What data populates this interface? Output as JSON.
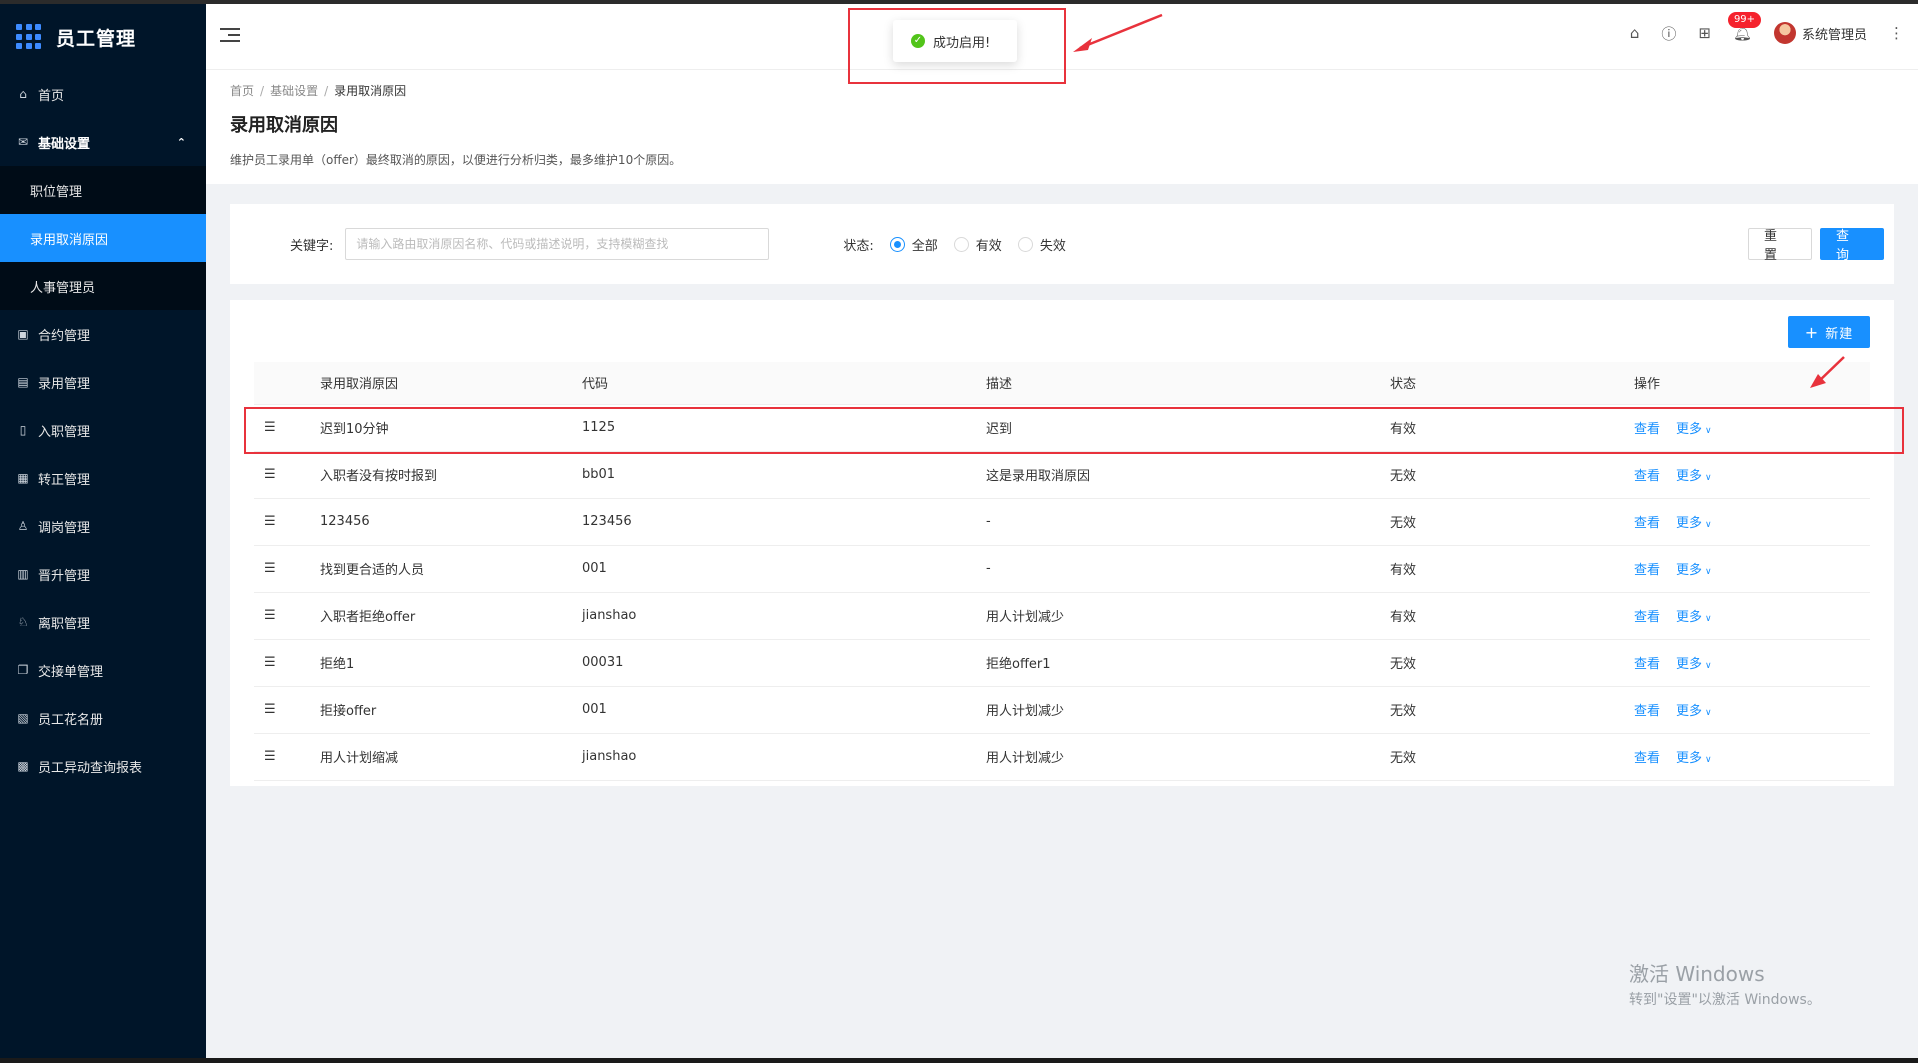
{
  "app": {
    "title": "员工管理"
  },
  "sidebar": {
    "items": [
      {
        "label": "首页",
        "icon": "home-icon",
        "glyph": "⌂"
      },
      {
        "label": "基础设置",
        "icon": "mail-icon",
        "glyph": "✉",
        "open": true,
        "children": [
          {
            "label": "职位管理"
          },
          {
            "label": "录用取消原因",
            "active": true
          },
          {
            "label": "人事管理员"
          }
        ]
      },
      {
        "label": "合约管理",
        "icon": "calendar-icon",
        "glyph": "▣"
      },
      {
        "label": "录用管理",
        "icon": "form-icon",
        "glyph": "▤"
      },
      {
        "label": "入职管理",
        "icon": "doc-icon",
        "glyph": "▯"
      },
      {
        "label": "转正管理",
        "icon": "grid-icon",
        "glyph": "▦"
      },
      {
        "label": "调岗管理",
        "icon": "user-icon",
        "glyph": "♙"
      },
      {
        "label": "晋升管理",
        "icon": "clipboard-icon",
        "glyph": "▥"
      },
      {
        "label": "离职管理",
        "icon": "user-leave-icon",
        "glyph": "♘"
      },
      {
        "label": "交接单管理",
        "icon": "copy-icon",
        "glyph": "❐"
      },
      {
        "label": "员工花名册",
        "icon": "book-icon",
        "glyph": "▧"
      },
      {
        "label": "员工异动查询报表",
        "icon": "report-icon",
        "glyph": "▩"
      }
    ]
  },
  "header": {
    "badge": "99+",
    "user_name": "系统管理员"
  },
  "toast": {
    "message": "成功启用!"
  },
  "breadcrumb": [
    "首页",
    "基础设置",
    "录用取消原因"
  ],
  "page": {
    "title": "录用取消原因",
    "description": "维护员工录用单（offer）最终取消的原因，以便进行分析归类，最多维护10个原因。"
  },
  "search": {
    "keyword_label": "关键字:",
    "placeholder": "请输入路由取消原因名称、代码或描述说明，支持模糊查找",
    "status_label": "状态:",
    "options": [
      "全部",
      "有效",
      "失效"
    ],
    "selected": "全部",
    "reset_label": "重 置",
    "query_label": "查 询"
  },
  "table": {
    "new_label": "新建",
    "columns": [
      "录用取消原因",
      "代码",
      "描述",
      "状态",
      "操作"
    ],
    "view_label": "查看",
    "more_label": "更多",
    "rows": [
      {
        "reason": "迟到10分钟",
        "code": "1125",
        "desc": "迟到",
        "status": "有效"
      },
      {
        "reason": "入职者没有按时报到",
        "code": "bb01",
        "desc": "这是录用取消原因",
        "status": "无效"
      },
      {
        "reason": "123456",
        "code": "123456",
        "desc": "-",
        "status": "无效"
      },
      {
        "reason": "找到更合适的人员",
        "code": "001",
        "desc": "-",
        "status": "有效"
      },
      {
        "reason": "入职者拒绝offer",
        "code": "jianshao",
        "desc": "用人计划减少",
        "status": "有效"
      },
      {
        "reason": "拒绝1",
        "code": "00031",
        "desc": "拒绝offer1",
        "status": "无效"
      },
      {
        "reason": "拒接offer",
        "code": "001",
        "desc": "用人计划减少",
        "status": "无效"
      },
      {
        "reason": "用人计划缩减",
        "code": "jianshao",
        "desc": "用人计划减少",
        "status": "无效"
      }
    ]
  },
  "watermark": {
    "line1": "激活 Windows",
    "line2": "转到\"设置\"以激活 Windows。"
  },
  "colors": {
    "accent": "#1890ff",
    "sidebar": "#001529",
    "highlight": "#e8323c",
    "success": "#52c41a"
  }
}
